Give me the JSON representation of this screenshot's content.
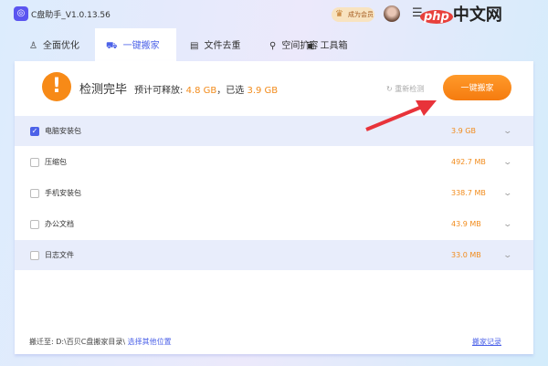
{
  "app": {
    "title": "C盘助手_V1.0.13.56",
    "vip_label": "成为会员",
    "watermark": "php中文网"
  },
  "tabs": [
    {
      "label": "全面优化",
      "icon": "rocket-icon"
    },
    {
      "label": "一键搬家",
      "icon": "truck-icon"
    },
    {
      "label": "文件去重",
      "icon": "file-copy-icon"
    },
    {
      "label": "空间扩容",
      "icon": "expand-icon"
    },
    {
      "label": "工具箱",
      "icon": "toolbox-icon"
    }
  ],
  "active_tab": 1,
  "summary": {
    "status": "检测完毕",
    "estimate_label": "预计可释放:",
    "estimate_value": "4.8 GB",
    "selected_label": "，已选",
    "selected_value": "3.9 GB",
    "rescan_label": "重新检测",
    "move_button": "一键搬家"
  },
  "items": [
    {
      "name": "电脑安装包",
      "size": "3.9 GB",
      "checked": true
    },
    {
      "name": "压缩包",
      "size": "492.7 MB",
      "checked": false
    },
    {
      "name": "手机安装包",
      "size": "338.7 MB",
      "checked": false
    },
    {
      "name": "办公文档",
      "size": "43.9 MB",
      "checked": false
    },
    {
      "name": "日志文件",
      "size": "33.0 MB",
      "checked": false
    }
  ],
  "footer": {
    "label": "搬迁至:",
    "path": "D:\\百贝C盘搬家目录\\",
    "choose_link": "选择其他位置",
    "history_link": "搬家记录"
  },
  "colors": {
    "accent": "#4c62e8",
    "orange": "#f78a17"
  }
}
